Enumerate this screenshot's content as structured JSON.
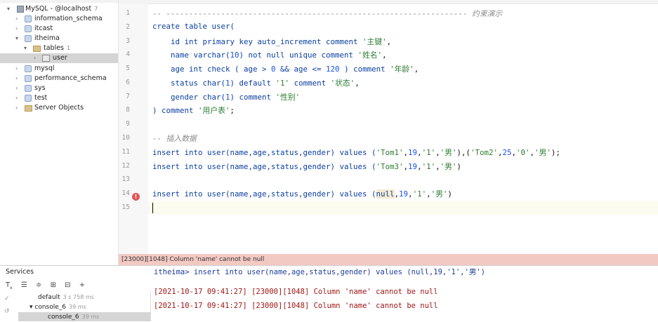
{
  "db_tree": {
    "root": {
      "label": "MySQL - @localhost",
      "badge": "7"
    },
    "schemas": [
      {
        "label": "information_schema"
      },
      {
        "label": "itcast"
      },
      {
        "label": "itheima"
      },
      {
        "label": "mysql"
      },
      {
        "label": "performance_schema"
      },
      {
        "label": "sys"
      },
      {
        "label": "test"
      },
      {
        "label": "Server Objects"
      }
    ],
    "tables_folder": {
      "label": "tables",
      "badge": "1"
    },
    "table_user": {
      "label": "user"
    }
  },
  "editor": {
    "line_numbers": [
      "1",
      "2",
      "3",
      "4",
      "5",
      "6",
      "7",
      "8",
      "9",
      "10",
      "11",
      "12",
      "13",
      "14",
      "15"
    ],
    "lines": {
      "l1_dash": "-- ------------------------------------------------------------------ ",
      "l1_title": "约束演示",
      "l2": "create table user(",
      "l3_a": "    id int primary key auto_increment comment ",
      "l3_s": "'主键'",
      "l4_a": "    name varchar(",
      "l4_n": "10",
      "l4_b": ") not null unique comment ",
      "l4_s": "'姓名'",
      "l5_a": "    age int check ( age > ",
      "l5_n1": "0",
      "l5_b": " && age <= ",
      "l5_n2": "120",
      "l5_c": " ) comment ",
      "l5_s": "'年龄'",
      "l6_a": "    status char(",
      "l6_n": "1",
      "l6_b": ") default ",
      "l6_s1": "'1'",
      "l6_c": " comment ",
      "l6_s2": "'状态'",
      "l7_a": "    gender char(",
      "l7_n": "1",
      "l7_b": ") comment ",
      "l7_s": "'性别'",
      "l8_a": ") comment ",
      "l8_s": "'用户表'",
      "l8_b": ";",
      "l10": "-- 插入数据",
      "l11_a": "insert into user(name,age,status,gender) values (",
      "l11_s1": "'Tom1'",
      "l11_n1": "19",
      "l11_s2": "'1'",
      "l11_s3": "'男'",
      "l11_s4": "'Tom2'",
      "l11_n2": "25",
      "l11_s5": "'0'",
      "l11_s6": "'男'",
      "l12_a": "insert into user(name,age,status,gender) values (",
      "l12_s1": "'Tom3'",
      "l12_n1": "19",
      "l12_s2": "'1'",
      "l12_s3": "'男'",
      "l14_a": "insert into user(name,age,status,gender) values (",
      "l14_null": "null",
      "l14_n1": "19",
      "l14_s1": "'1'",
      "l14_s2": "'男'"
    },
    "error_marker": "!",
    "error_message": "[23000][1048] Column 'name' cannot be null"
  },
  "services": {
    "title": "Services",
    "tree": [
      {
        "label": "default",
        "time": "3 s 758 ms"
      },
      {
        "label": "console_6",
        "time": "39 ms"
      },
      {
        "label": "console_6",
        "time": "39 ms"
      }
    ],
    "console": {
      "cut_line": "itheima> insert into user(name,age,status,gender) values (null,19,'1','男')",
      "lines": [
        "[2021-10-17 09:41:27] [23000][1048] Column 'name' cannot be null",
        "[2021-10-17 09:41:27] [23000][1048] Column 'name' cannot be null"
      ]
    }
  },
  "colors": {
    "keyword": "#0b3fa0",
    "string": "#2e7d32",
    "number": "#1750eb",
    "error_bar": "#f3c9c3",
    "error_text": "#a01818"
  }
}
